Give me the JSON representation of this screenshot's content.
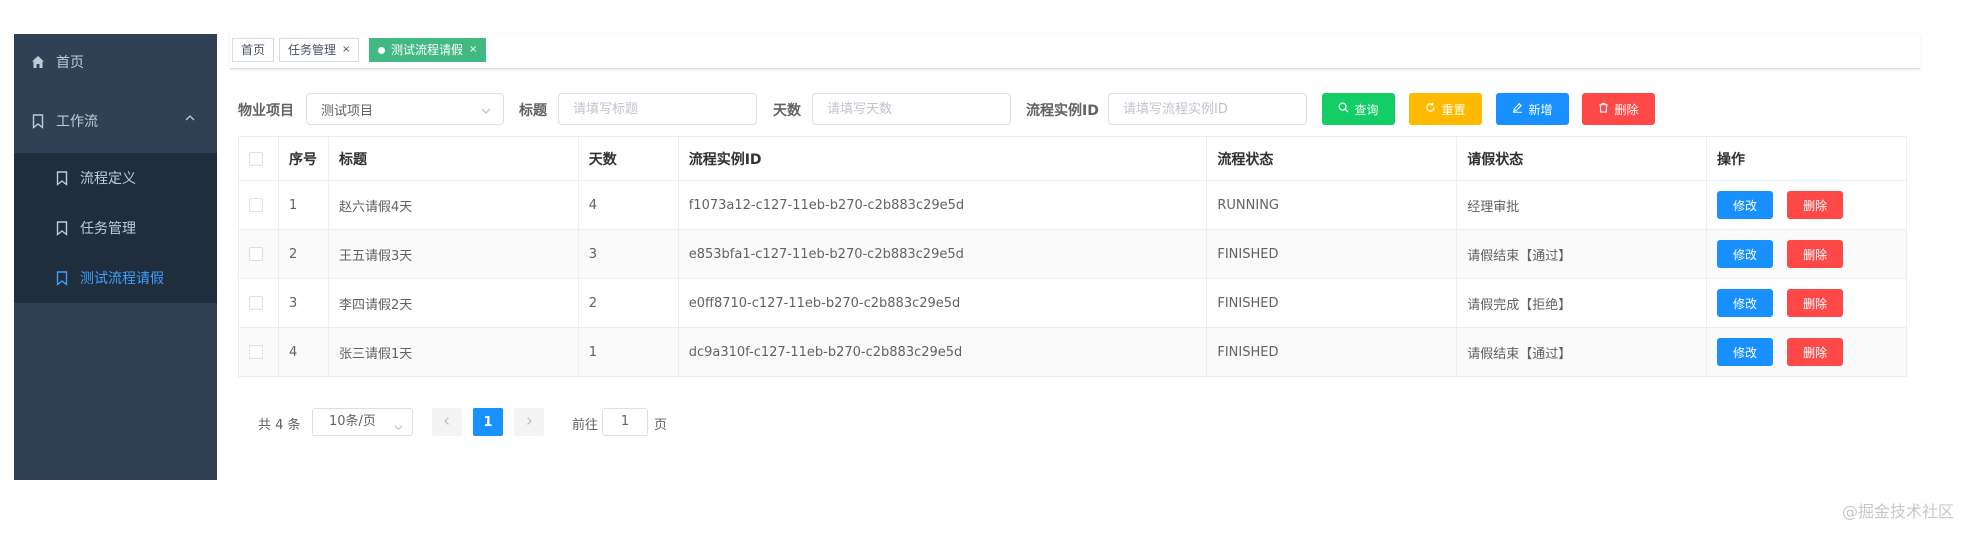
{
  "sidebar": {
    "home": "首页",
    "workflow": "工作流",
    "items": [
      {
        "label": "流程定义",
        "active": false
      },
      {
        "label": "任务管理",
        "active": false
      },
      {
        "label": "测试流程请假",
        "active": true
      }
    ]
  },
  "tags": {
    "home": "首页",
    "task": "任务管理",
    "active": "测试流程请假",
    "close": "×"
  },
  "filters": {
    "property_label": "物业项目",
    "property_value": "测试项目",
    "title_label": "标题",
    "title_placeholder": "请填写标题",
    "days_label": "天数",
    "days_placeholder": "请填写天数",
    "instance_label": "流程实例ID",
    "instance_placeholder": "请填写流程实例ID"
  },
  "buttons": {
    "query": "查询",
    "reset": "重置",
    "add": "新增",
    "delete": "删除"
  },
  "table": {
    "columns": [
      "序号",
      "标题",
      "天数",
      "流程实例ID",
      "流程状态",
      "请假状态",
      "操作"
    ],
    "rows": [
      {
        "no": "1",
        "title": "赵六请假4天",
        "days": "4",
        "id": "f1073a12-c127-11eb-b270-c2b883c29e5d",
        "status": "RUNNING",
        "leave": "经理审批"
      },
      {
        "no": "2",
        "title": "王五请假3天",
        "days": "3",
        "id": "e853bfa1-c127-11eb-b270-c2b883c29e5d",
        "status": "FINISHED",
        "leave": "请假结束【通过】"
      },
      {
        "no": "3",
        "title": "李四请假2天",
        "days": "2",
        "id": "e0ff8710-c127-11eb-b270-c2b883c29e5d",
        "status": "FINISHED",
        "leave": "请假完成【拒绝】"
      },
      {
        "no": "4",
        "title": "张三请假1天",
        "days": "1",
        "id": "dc9a310f-c127-11eb-b270-c2b883c29e5d",
        "status": "FINISHED",
        "leave": "请假结束【通过】"
      }
    ],
    "edit": "修改",
    "remove": "删除"
  },
  "pagination": {
    "total": "共 4 条",
    "page_size": "10条/页",
    "current": "1",
    "goto": "前往",
    "goto_value": "1",
    "page_unit": "页"
  },
  "watermark": "@掘金技术社区",
  "colors": {
    "sidebar_bg": "#304156",
    "submenu_bg": "#1f2d3d",
    "active_link": "#409eff",
    "tag_active": "#42b983",
    "btn_green": "#13ce66",
    "btn_orange": "#ffba00",
    "btn_blue": "#1890ff",
    "btn_red": "#ff4949"
  }
}
